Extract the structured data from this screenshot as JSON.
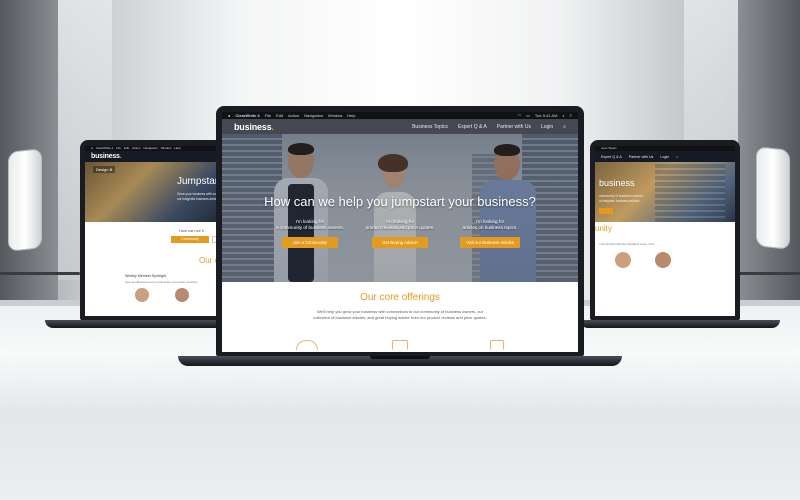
{
  "center": {
    "menubar": {
      "app": "ClearWhite 4",
      "menus": [
        "File",
        "Edit",
        "Action",
        "Navigation",
        "Window",
        "Help"
      ],
      "clock": "Tue 9:41 AM"
    },
    "logo": "business",
    "nav": [
      "Business Topics",
      "Expert Q & A",
      "Partner with Us",
      "Login"
    ],
    "hero_title": "How can we help you jumpstart your business?",
    "ctas": [
      {
        "text": "I'm looking for\na community of business owners.",
        "button": "Join a Community!"
      },
      {
        "text": "I'm looking for\nproduct reviews and price quotes.",
        "button": "Get Buying Advice!"
      },
      {
        "text": "I'm looking for\narticles on business topics.",
        "button": "Visit our Business Articles"
      }
    ],
    "offerings_title": "Our core offerings",
    "offerings_desc": "We'll help you grow your business with connections to our community of business owners, our\ncollection of business articles, and great buying advice from our product reviews and price quotes."
  },
  "left": {
    "menubar_app": "ClearWhite 4",
    "menus": [
      "File",
      "Edit",
      "Action",
      "Navigation",
      "Window",
      "Help"
    ],
    "logo": "business",
    "design_label": "Design B",
    "hero_title": "Jumpstar",
    "hero_text": "Grow your business with conn\nour insightful business article",
    "how_text": "How can we h",
    "community_btn": "Community",
    "tab_letter": "O",
    "section_title": "Our c",
    "spotlight_title": "Weekly Member Spotlight",
    "spotlight_text": "Here are Business.com's most active community members"
  },
  "right": {
    "menubar_nav": "ness Topics",
    "nav": [
      "Expert Q & A",
      "Partner with Us",
      "Login"
    ],
    "logo": "business",
    "hero_text": "community of business owners,\nul insightful business articles",
    "section_title": "unity",
    "spotlight_text": "n the Monthly Member Spotlight! Learn more"
  },
  "colors": {
    "accent": "#e39b1f",
    "dark": "#1b1c21"
  }
}
